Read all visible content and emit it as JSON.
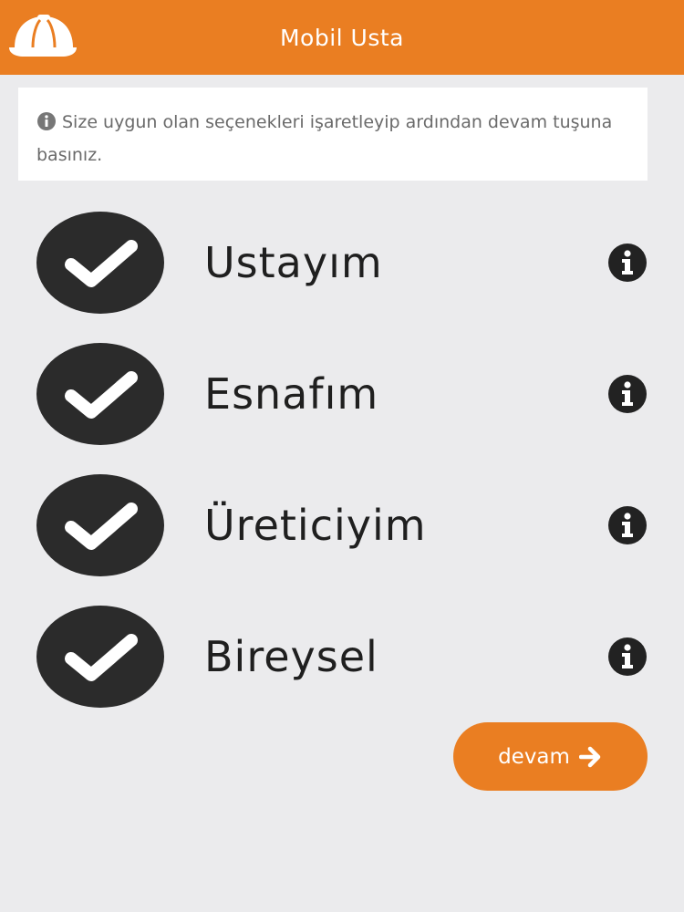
{
  "header": {
    "title": "Mobil Usta",
    "logo_icon": "hard-hat-icon"
  },
  "notice": {
    "icon": "info-circle-icon",
    "text": "Size uygun olan seçenekleri işaretleyip ardından devam tuşuna basınız."
  },
  "options": [
    {
      "label": "Ustayım",
      "checked": true
    },
    {
      "label": "Esnafım",
      "checked": true
    },
    {
      "label": "Üreticiyim",
      "checked": true
    },
    {
      "label": "Bireysel",
      "checked": true
    }
  ],
  "continue_button": {
    "label": "devam",
    "icon": "arrow-right-icon"
  },
  "colors": {
    "accent": "#ea7e22",
    "background": "#ebebed",
    "check_circle": "#2b2b2b"
  }
}
